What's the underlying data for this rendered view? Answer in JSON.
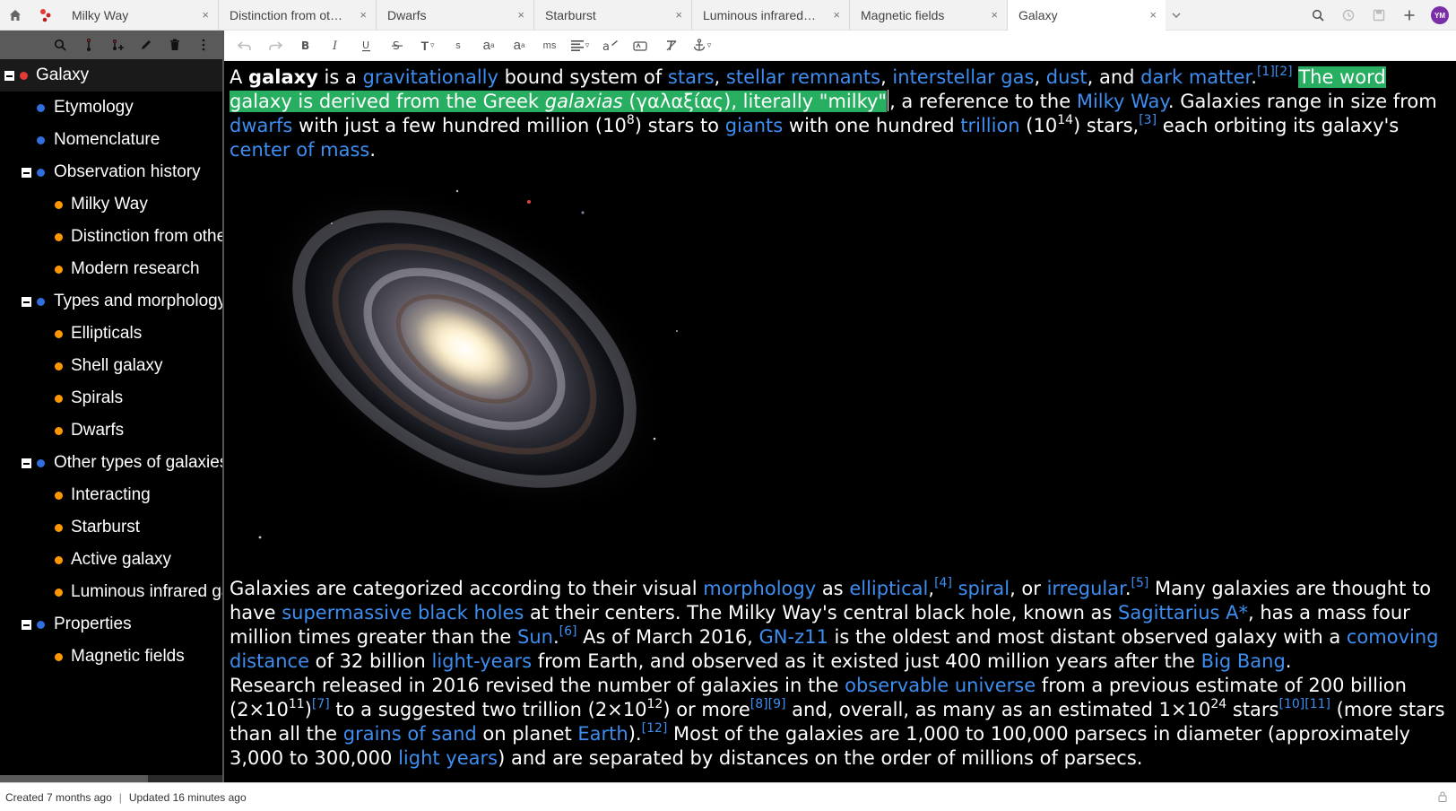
{
  "tabs": [
    {
      "title": "Milky Way",
      "close": "×"
    },
    {
      "title": "Distinction from ot…",
      "close": "×"
    },
    {
      "title": "Dwarfs",
      "close": "×"
    },
    {
      "title": "Starburst",
      "close": "×"
    },
    {
      "title": "Luminous infrared…",
      "close": "×"
    },
    {
      "title": "Magnetic fields",
      "close": "×"
    },
    {
      "title": "Galaxy",
      "close": "×",
      "active": true
    }
  ],
  "user": {
    "initials": "YM",
    "color": "#7a2fa8"
  },
  "tree": [
    {
      "label": "Galaxy",
      "level": 0,
      "expanded": true,
      "dot": "#e53935"
    },
    {
      "label": "Etymology",
      "level": 1,
      "dot": "#2f6fde"
    },
    {
      "label": "Nomenclature",
      "level": 1,
      "dot": "#2f6fde"
    },
    {
      "label": "Observation history",
      "level": 1,
      "expanded": true,
      "dot": "#2f6fde"
    },
    {
      "label": "Milky Way",
      "level": 2,
      "dot": "#ff9800"
    },
    {
      "label": "Distinction from other nebulae",
      "level": 2,
      "dot": "#ff9800"
    },
    {
      "label": "Modern research",
      "level": 2,
      "dot": "#ff9800"
    },
    {
      "label": "Types and morphology",
      "level": 1,
      "expanded": true,
      "dot": "#2f6fde"
    },
    {
      "label": "Ellipticals",
      "level": 2,
      "dot": "#ff9800"
    },
    {
      "label": "Shell galaxy",
      "level": 2,
      "dot": "#ff9800"
    },
    {
      "label": "Spirals",
      "level": 2,
      "dot": "#ff9800"
    },
    {
      "label": "Dwarfs",
      "level": 2,
      "dot": "#ff9800"
    },
    {
      "label": "Other types of galaxies",
      "level": 1,
      "expanded": true,
      "dot": "#2f6fde"
    },
    {
      "label": "Interacting",
      "level": 2,
      "dot": "#ff9800"
    },
    {
      "label": "Starburst",
      "level": 2,
      "dot": "#ff9800"
    },
    {
      "label": "Active galaxy",
      "level": 2,
      "dot": "#ff9800"
    },
    {
      "label": "Luminous infrared galaxy",
      "level": 2,
      "dot": "#ff9800"
    },
    {
      "label": "Properties",
      "level": 1,
      "expanded": true,
      "dot": "#2f6fde"
    },
    {
      "label": "Magnetic fields",
      "level": 2,
      "dot": "#ff9800"
    }
  ],
  "toolbar": {
    "subscript_s": "s",
    "monospace": "ms",
    "text_size": "T",
    "superscript": "a",
    "subscript": "a"
  },
  "article": {
    "p1": {
      "t01": "A ",
      "t02": "galaxy",
      "t03": " is a ",
      "t04": "gravitationally",
      "t05": " bound system of ",
      "t06": "stars",
      "t07": ", ",
      "t08": "stellar remnants",
      "t09": ", ",
      "t10": "interstellar gas",
      "t11": ", ",
      "t12": "dust",
      "t13": ", and ",
      "t14": "dark matter",
      "t15": ".",
      "r1": "[1]",
      "r2": "[2]",
      "t16": " ",
      "h1": "The word galaxy is derived from the Greek ",
      "h2": "galaxias",
      "h3": " (γαλαξίας), literally \"milky\"",
      "t17": ", a reference to the ",
      "t18": "Milky Way",
      "t19": ". Galaxies range in size from ",
      "t20": "dwarfs",
      "t21": " with just a few hundred million (10",
      "s1": "8",
      "t22": ") stars to ",
      "t23": "giants",
      "t24": " with one hundred ",
      "t25": "trillion",
      "t26": " (10",
      "s2": "14",
      "t27": ") stars,",
      "r3": "[3]",
      "t28": " each orbiting its galaxy's ",
      "t29": "center of mass",
      "t30": "."
    },
    "p2": {
      "t01": "Galaxies are categorized according to their visual ",
      "t02": "morphology",
      "t03": " as ",
      "t04": "elliptical",
      "t05": ",",
      "r4": "[4]",
      "t06": " ",
      "t07": "spiral",
      "t08": ", or ",
      "t09": "irregular",
      "t10": ".",
      "r5": "[5]",
      "t11": " Many galaxies are thought to have ",
      "t12": "supermassive black holes",
      "t13": " at their centers. The Milky Way's central black hole, known as ",
      "t14": "Sagittarius A*",
      "t15": ", has a mass four million times greater than the ",
      "t16": "Sun",
      "t17": ".",
      "r6": "[6]",
      "t18": " As of March 2016, ",
      "t19": "GN-z11",
      "t20": " is the oldest and most distant observed galaxy with a ",
      "t21": "comoving distance",
      "t22": " of 32 billion ",
      "t23": "light-years",
      "t24": " from Earth, and observed as it existed just 400 million years after the ",
      "t25": "Big Bang",
      "t26": "."
    },
    "p3": {
      "t01": "Research released in 2016 revised the number of galaxies in the ",
      "t02": "observable universe",
      "t03": " from a previous estimate of 200 billion (2×10",
      "s1": "11",
      "t04": ")",
      "r7": "[7]",
      "t05": " to a suggested two trillion (2×10",
      "s2": "12",
      "t06": ") or more",
      "r8": "[8]",
      "r9": "[9]",
      "t07": " and, overall, as many as an estimated 1×10",
      "s3": "24",
      "t08": " stars",
      "r10": "[10]",
      "r11": "[11]",
      "t09": " (more stars than all the ",
      "t10": "grains of sand",
      "t11": " on planet ",
      "t12": "Earth",
      "t13": ").",
      "r12": "[12]",
      "t14": " Most of the galaxies are 1,000 to 100,000 parsecs in diameter (approximately 3,000 to 300,000 ",
      "t15": "light years",
      "t16": ") and are separated by distances on the order of millions of parsecs."
    }
  },
  "status": {
    "created": "Created 7 months ago",
    "separator": "|",
    "updated": "Updated 16 minutes ago"
  },
  "colors": {
    "link": "#3d8ef0",
    "highlight": "#27ae60",
    "background": "#000000"
  }
}
